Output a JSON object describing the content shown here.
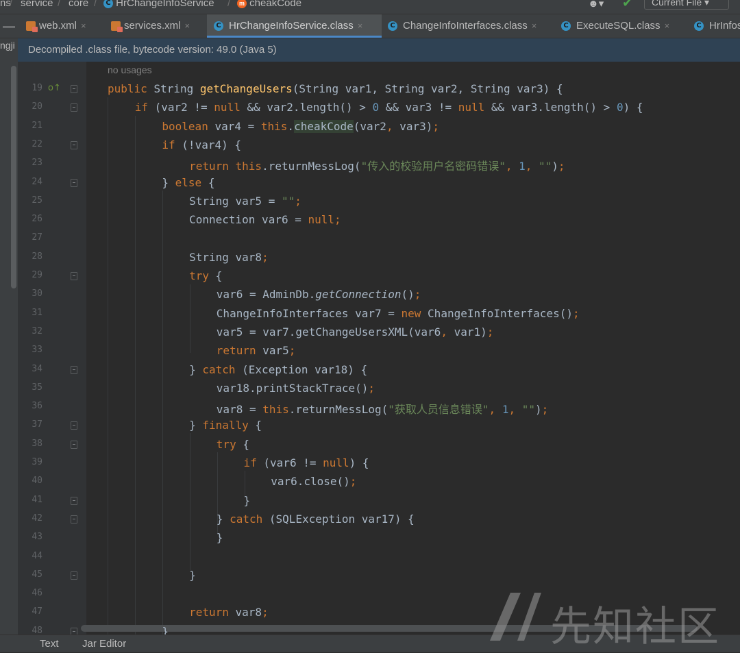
{
  "breadcrumb": {
    "items": [
      "ns",
      "service",
      "core",
      "HrChangeInfoService",
      "cheakCode"
    ],
    "sep": "/"
  },
  "toolbar": {
    "run_config": "Current File",
    "run_config_arrow": "▾",
    "user_icon": "user-icon",
    "build_icon": "hammer-icon"
  },
  "tabs": [
    {
      "label": "web.xml",
      "icon": "xml-file-icon",
      "active": false
    },
    {
      "label": "services.xml",
      "icon": "xml-file-icon",
      "active": false
    },
    {
      "label": "HrChangeInfoService.class",
      "icon": "class-icon",
      "active": true
    },
    {
      "label": "ChangeInfoInterfaces.class",
      "icon": "class-icon",
      "active": false
    },
    {
      "label": "ExecuteSQL.class",
      "icon": "class-icon",
      "active": false
    },
    {
      "label": "HrInfos",
      "icon": "class-icon",
      "active": false
    }
  ],
  "tab_close": "×",
  "class_icon_letter": "C",
  "method_icon_letter": "m",
  "left_panel_label": "ngji",
  "banner": "Decompiled .class file, bytecode version: 49.0 (Java 5)",
  "editor": {
    "usages_hint": "no usages",
    "lines": [
      {
        "n": "19",
        "segs": [
          [
            "kw",
            "public "
          ],
          [
            "",
            "String "
          ],
          [
            "fn",
            "getChangeUsers"
          ],
          [
            "",
            "(String var1, String var2, String var3) {"
          ]
        ]
      },
      {
        "n": "20",
        "segs": [
          [
            "kw",
            "if "
          ],
          [
            "",
            "(var2 != "
          ],
          [
            "kw",
            "null "
          ],
          [
            "",
            "&& var2.length() > "
          ],
          [
            "num",
            "0 "
          ],
          [
            "",
            "&& var3 != "
          ],
          [
            "kw",
            "null "
          ],
          [
            "",
            "&& var3.length() > "
          ],
          [
            "num",
            "0"
          ],
          [
            "",
            ") {"
          ]
        ]
      },
      {
        "n": "21",
        "segs": [
          [
            "kw",
            "boolean "
          ],
          [
            "",
            "var4 = "
          ],
          [
            "kw",
            "this"
          ],
          [
            "",
            "."
          ],
          [
            "hl",
            "cheakCode"
          ],
          [
            "",
            "(var2"
          ],
          [
            "kw",
            ", "
          ],
          [
            "",
            "var3)"
          ],
          [
            "kw",
            ";"
          ]
        ]
      },
      {
        "n": "22",
        "segs": [
          [
            "kw",
            "if "
          ],
          [
            "",
            "(!var4) {"
          ]
        ]
      },
      {
        "n": "23",
        "segs": [
          [
            "kw",
            "return this"
          ],
          [
            "",
            ".returnMessLog("
          ],
          [
            "str",
            "\"传入的校验用户名密码错误\""
          ],
          [
            "kw",
            ", "
          ],
          [
            "num",
            "1"
          ],
          [
            "kw",
            ", "
          ],
          [
            "str",
            "\"\""
          ],
          [
            "",
            ")"
          ],
          [
            "kw",
            ";"
          ]
        ]
      },
      {
        "n": "24",
        "segs": [
          [
            "",
            "} "
          ],
          [
            "kw",
            "else "
          ],
          [
            "",
            "{"
          ]
        ]
      },
      {
        "n": "25",
        "segs": [
          [
            "",
            "String var5 = "
          ],
          [
            "str",
            "\"\""
          ],
          [
            "kw",
            ";"
          ]
        ]
      },
      {
        "n": "26",
        "segs": [
          [
            "",
            "Connection var6 = "
          ],
          [
            "kw",
            "null;"
          ]
        ]
      },
      {
        "n": "27",
        "segs": []
      },
      {
        "n": "28",
        "segs": [
          [
            "",
            "String var8"
          ],
          [
            "kw",
            ";"
          ]
        ]
      },
      {
        "n": "29",
        "segs": [
          [
            "kw",
            "try "
          ],
          [
            "",
            "{"
          ]
        ]
      },
      {
        "n": "30",
        "segs": [
          [
            "",
            "var6 = AdminDb."
          ],
          [
            "it",
            "getConnection"
          ],
          [
            "",
            "()"
          ],
          [
            "kw",
            ";"
          ]
        ]
      },
      {
        "n": "31",
        "segs": [
          [
            "",
            "ChangeInfoInterfaces var7 = "
          ],
          [
            "kw",
            "new "
          ],
          [
            "",
            "ChangeInfoInterfaces()"
          ],
          [
            "kw",
            ";"
          ]
        ]
      },
      {
        "n": "32",
        "segs": [
          [
            "",
            "var5 = var7.getChangeUsersXML(var6"
          ],
          [
            "kw",
            ", "
          ],
          [
            "",
            "var1)"
          ],
          [
            "kw",
            ";"
          ]
        ]
      },
      {
        "n": "33",
        "segs": [
          [
            "kw",
            "return "
          ],
          [
            "",
            "var5"
          ],
          [
            "kw",
            ";"
          ]
        ]
      },
      {
        "n": "34",
        "segs": [
          [
            "",
            "} "
          ],
          [
            "kw",
            "catch "
          ],
          [
            "",
            "(Exception var18) {"
          ]
        ]
      },
      {
        "n": "35",
        "segs": [
          [
            "",
            "var18.printStackTrace()"
          ],
          [
            "kw",
            ";"
          ]
        ]
      },
      {
        "n": "36",
        "segs": [
          [
            "",
            "var8 = "
          ],
          [
            "kw",
            "this"
          ],
          [
            "",
            ".returnMessLog("
          ],
          [
            "str",
            "\"获取人员信息错误\""
          ],
          [
            "kw",
            ", "
          ],
          [
            "num",
            "1"
          ],
          [
            "kw",
            ", "
          ],
          [
            "str",
            "\"\""
          ],
          [
            "",
            ")"
          ],
          [
            "kw",
            ";"
          ]
        ]
      },
      {
        "n": "37",
        "segs": [
          [
            "",
            "} "
          ],
          [
            "kw",
            "finally "
          ],
          [
            "",
            "{"
          ]
        ]
      },
      {
        "n": "38",
        "segs": [
          [
            "kw",
            "try "
          ],
          [
            "",
            "{"
          ]
        ]
      },
      {
        "n": "39",
        "segs": [
          [
            "kw",
            "if "
          ],
          [
            "",
            "(var6 != "
          ],
          [
            "kw",
            "null"
          ],
          [
            "",
            ") {"
          ]
        ]
      },
      {
        "n": "40",
        "segs": [
          [
            "",
            "var6.close()"
          ],
          [
            "kw",
            ";"
          ]
        ]
      },
      {
        "n": "41",
        "segs": [
          [
            "",
            "}"
          ]
        ]
      },
      {
        "n": "42",
        "segs": [
          [
            "",
            "} "
          ],
          [
            "kw",
            "catch "
          ],
          [
            "",
            "(SQLException var17) {"
          ]
        ]
      },
      {
        "n": "43",
        "segs": [
          [
            "",
            "}"
          ]
        ]
      },
      {
        "n": "44",
        "segs": []
      },
      {
        "n": "45",
        "segs": [
          [
            "",
            "}"
          ]
        ]
      },
      {
        "n": "46",
        "segs": []
      },
      {
        "n": "47",
        "segs": [
          [
            "kw",
            "return "
          ],
          [
            "",
            "var8"
          ],
          [
            "kw",
            ";"
          ]
        ]
      },
      {
        "n": "48",
        "segs": [
          [
            "",
            "}"
          ]
        ]
      }
    ]
  },
  "bottom_tabs": [
    "Text",
    "Jar Editor"
  ],
  "watermark": {
    "text": "先知社区",
    "icon": "xianzhi-logo-icon"
  }
}
